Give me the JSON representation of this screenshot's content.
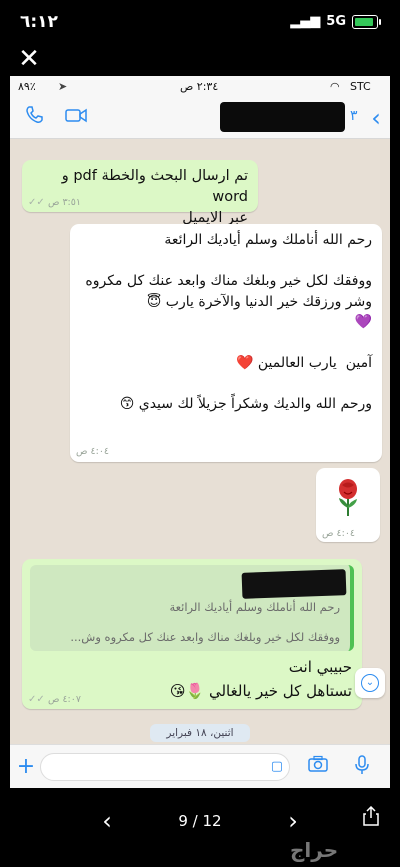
{
  "outer_status": {
    "time": "٦:١٢",
    "network": "5G",
    "battery_level": 0.9
  },
  "close_label": "✕",
  "inner_status": {
    "carrier": "STC",
    "time": "٢:٣٤ ص",
    "battery": "٨٩٪"
  },
  "header": {
    "back_count": "٣"
  },
  "messages": [
    {
      "id": "m1",
      "direction": "out",
      "text": "تم ارسال البحث والخطة pdf و word\nعبر الايميل",
      "time": "٣:٥١ ص"
    },
    {
      "id": "m2",
      "direction": "in",
      "text": "رحم الله أناملك وسلم أياديك الرائعة\n\nووفقك لكل خير وبلغك مناك وابعد عنك كل مكروه وشر ورزقك خير الدنيا والآخرة يارب 😇\n💜\n\nآمين  يارب العالمين ❤️\n\nورحم الله والديك وشكراً جزيلاً لك سيدي 😙",
      "time": "٤:٠٤ ص"
    },
    {
      "id": "m3",
      "direction": "in",
      "text": "🌹",
      "time": "٤:٠٤ ص"
    },
    {
      "id": "m4",
      "direction": "out",
      "quote_line1": "رحم الله أناملك وسلم أياديك الرائعة",
      "quote_line2": "ووفقك لكل خير وبلغك مناك وابعد عنك كل مكروه وش...",
      "text": "حبيبي انت\nتستاهل كل خير يالغالي 🌷😘",
      "time": "٤:٠٧ ص"
    }
  ],
  "date_divider": "اثنين، ١٨ فبراير",
  "viewer": {
    "page_counter": "9 / 12",
    "watermark": "حراج"
  }
}
